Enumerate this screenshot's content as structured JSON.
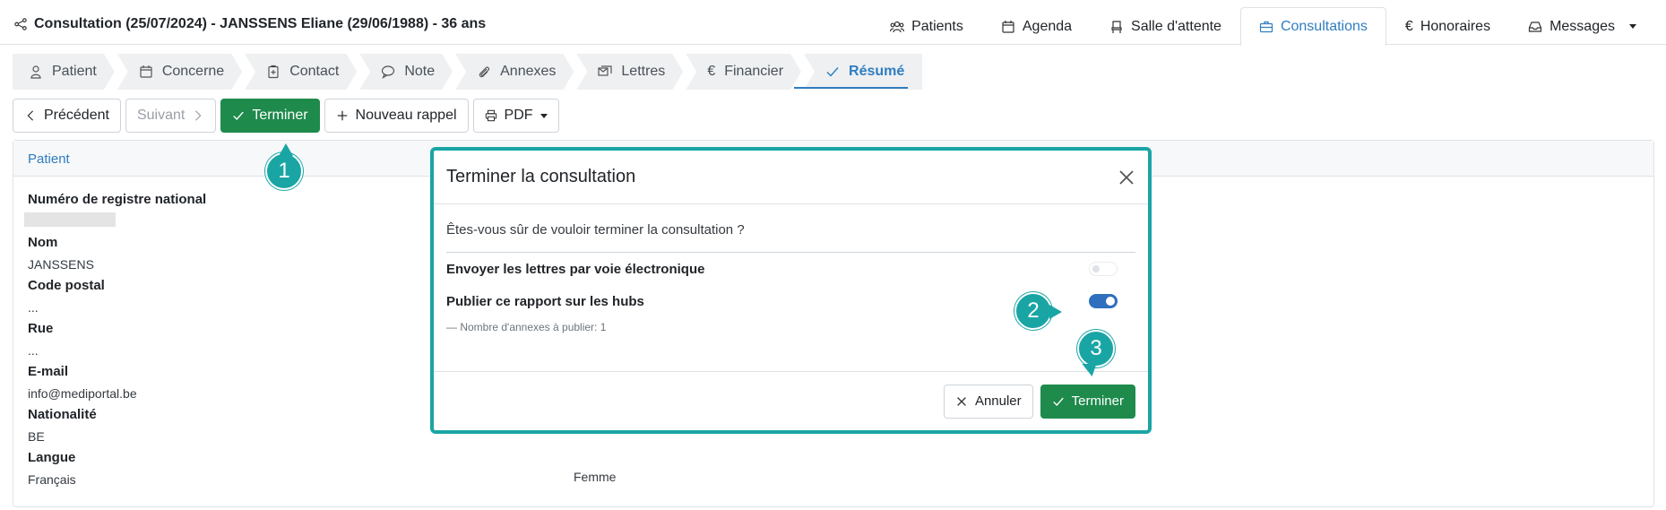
{
  "header": {
    "title": "Consultation (25/07/2024) - JANSSENS Eliane (29/06/1988) - 36 ans"
  },
  "nav": {
    "tabs": [
      {
        "label": "Patients",
        "icon": "users-icon"
      },
      {
        "label": "Agenda",
        "icon": "calendar-icon"
      },
      {
        "label": "Salle d'attente",
        "icon": "chair-icon"
      },
      {
        "label": "Consultations",
        "icon": "briefcase-icon",
        "active": true
      },
      {
        "label": "Honoraires",
        "icon": "euro-icon"
      },
      {
        "label": "Messages",
        "icon": "inbox-icon"
      }
    ]
  },
  "steps": [
    {
      "label": "Patient",
      "icon": "user-icon"
    },
    {
      "label": "Concerne",
      "icon": "calendar-icon"
    },
    {
      "label": "Contact",
      "icon": "clipboard-plus-icon"
    },
    {
      "label": "Note",
      "icon": "comment-icon"
    },
    {
      "label": "Annexes",
      "icon": "paperclip-icon"
    },
    {
      "label": "Lettres",
      "icon": "envelopes-icon"
    },
    {
      "label": "Financier",
      "icon": "euro-icon"
    },
    {
      "label": "Résumé",
      "icon": "check-icon",
      "active": true
    }
  ],
  "toolbar": {
    "prev": "Précédent",
    "next": "Suivant",
    "finish": "Terminer",
    "reminder": "Nouveau rappel",
    "pdf": "PDF"
  },
  "card": {
    "header": "Patient",
    "fields": {
      "niss_label": "Numéro de registre national",
      "nom_label": "Nom",
      "nom_value": "JANSSENS",
      "cp_label": "Code postal",
      "cp_value": "...",
      "rue_label": "Rue",
      "rue_value": "...",
      "email_label": "E-mail",
      "email_value": "info@mediportal.be",
      "nat_label": "Nationalité",
      "nat_value": "BE",
      "langue_label": "Langue",
      "langue_value": "Français"
    },
    "sexe_value": "Femme"
  },
  "modal": {
    "title": "Terminer la consultation",
    "question": "Êtes-vous sûr de vouloir terminer la consultation ?",
    "opt_letters": "Envoyer les lettres par voie électronique",
    "opt_letters_on": false,
    "opt_hubs": "Publier ce rapport sur les hubs",
    "opt_hubs_on": true,
    "hubs_note": "—  Nombre d'annexes à publier: 1",
    "cancel": "Annuler",
    "confirm": "Terminer"
  },
  "callouts": [
    "1",
    "2",
    "3"
  ],
  "colors": {
    "accent": "#2f7dbf",
    "success": "#1e8a4c",
    "callout": "#1aa5a5",
    "toggle_on": "#2f6fbd"
  }
}
